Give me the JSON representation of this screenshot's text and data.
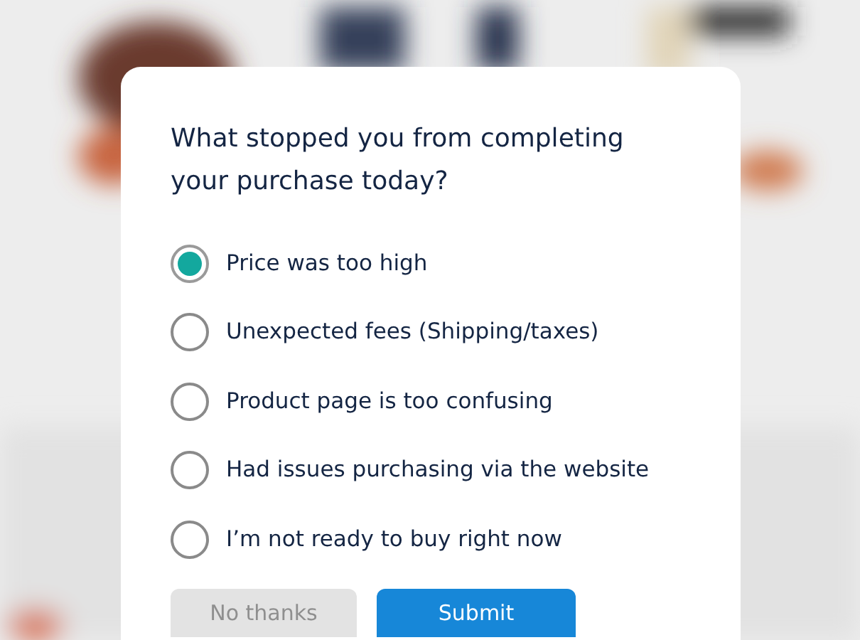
{
  "survey": {
    "question": "What stopped you from completing your purchase today?",
    "options": [
      {
        "label": "Price was too high",
        "selected": true
      },
      {
        "label": "Unexpected fees (Shipping/taxes)",
        "selected": false
      },
      {
        "label": "Product page is too confusing",
        "selected": false
      },
      {
        "label": "Had issues purchasing via the website",
        "selected": false
      },
      {
        "label": "I’m not ready to buy right now",
        "selected": false
      }
    ],
    "buttons": [
      {
        "label": "No thanks",
        "kind": "secondary"
      },
      {
        "label": "Submit",
        "kind": "primary"
      }
    ]
  }
}
